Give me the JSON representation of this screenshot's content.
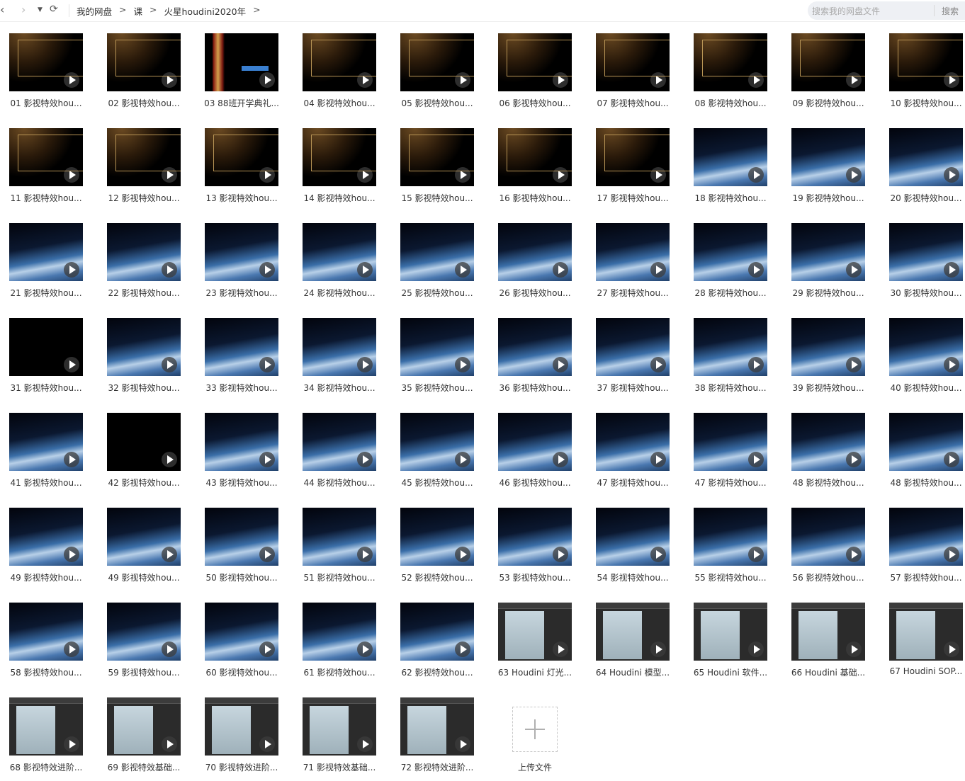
{
  "toolbar": {
    "back_icon": "chevron-left-icon",
    "forward_icon": "chevron-right-icon",
    "dropdown_icon": "caret-down-icon",
    "refresh_icon": "refresh-icon"
  },
  "breadcrumb": [
    "我的网盘",
    "课",
    "火星houdini2020年"
  ],
  "breadcrumb_separator": ">",
  "search": {
    "placeholder": "搜索我的网盘文件",
    "button": "搜索"
  },
  "files": [
    {
      "name": "01 影视特效hou...",
      "thumb": "fire"
    },
    {
      "name": "02 影视特效hou...",
      "thumb": "fire"
    },
    {
      "name": "03 88班开学典礼...",
      "thumb": "red"
    },
    {
      "name": "04 影视特效hou...",
      "thumb": "fire"
    },
    {
      "name": "05 影视特效hou...",
      "thumb": "fire"
    },
    {
      "name": "06 影视特效hou...",
      "thumb": "fire"
    },
    {
      "name": "07 影视特效hou...",
      "thumb": "fire"
    },
    {
      "name": "08 影视特效hou...",
      "thumb": "fire"
    },
    {
      "name": "09 影视特效hou...",
      "thumb": "fire"
    },
    {
      "name": "10 影视特效hou...",
      "thumb": "fire"
    },
    {
      "name": "11 影视特效hou...",
      "thumb": "fire"
    },
    {
      "name": "12 影视特效hou...",
      "thumb": "fire"
    },
    {
      "name": "13 影视特效hou...",
      "thumb": "fire"
    },
    {
      "name": "14 影视特效hou...",
      "thumb": "fire"
    },
    {
      "name": "15 影视特效hou...",
      "thumb": "fire"
    },
    {
      "name": "16 影视特效hou...",
      "thumb": "fire"
    },
    {
      "name": "17 影视特效hou...",
      "thumb": "fire"
    },
    {
      "name": "18 影视特效hou...",
      "thumb": "earth"
    },
    {
      "name": "19 影视特效hou...",
      "thumb": "earth"
    },
    {
      "name": "20 影视特效hou...",
      "thumb": "earth"
    },
    {
      "name": "21 影视特效hou...",
      "thumb": "earth"
    },
    {
      "name": "22 影视特效hou...",
      "thumb": "earth"
    },
    {
      "name": "23 影视特效hou...",
      "thumb": "earth"
    },
    {
      "name": "24 影视特效hou...",
      "thumb": "earth"
    },
    {
      "name": "25 影视特效hou...",
      "thumb": "earth"
    },
    {
      "name": "26 影视特效hou...",
      "thumb": "earth"
    },
    {
      "name": "27 影视特效hou...",
      "thumb": "earth"
    },
    {
      "name": "28 影视特效hou...",
      "thumb": "earth"
    },
    {
      "name": "29 影视特效hou...",
      "thumb": "earth"
    },
    {
      "name": "30 影视特效hou...",
      "thumb": "earth"
    },
    {
      "name": "31 影视特效hou...",
      "thumb": "black"
    },
    {
      "name": "32 影视特效hou...",
      "thumb": "earth"
    },
    {
      "name": "33 影视特效hou...",
      "thumb": "earth"
    },
    {
      "name": "34 影视特效hou...",
      "thumb": "earth"
    },
    {
      "name": "35 影视特效hou...",
      "thumb": "earth"
    },
    {
      "name": "36 影视特效hou...",
      "thumb": "earth"
    },
    {
      "name": "37 影视特效hou...",
      "thumb": "earth"
    },
    {
      "name": "38 影视特效hou...",
      "thumb": "earth"
    },
    {
      "name": "39 影视特效hou...",
      "thumb": "earth"
    },
    {
      "name": "40 影视特效hou...",
      "thumb": "earth"
    },
    {
      "name": "41 影视特效hou...",
      "thumb": "earth"
    },
    {
      "name": "42 影视特效hou...",
      "thumb": "black"
    },
    {
      "name": "43 影视特效hou...",
      "thumb": "earth"
    },
    {
      "name": "44 影视特效hou...",
      "thumb": "earth"
    },
    {
      "name": "45 影视特效hou...",
      "thumb": "earth"
    },
    {
      "name": "46 影视特效hou...",
      "thumb": "earth"
    },
    {
      "name": "47 影视特效hou...",
      "thumb": "earth"
    },
    {
      "name": "47 影视特效hou...",
      "thumb": "earth"
    },
    {
      "name": "48 影视特效hou...",
      "thumb": "earth"
    },
    {
      "name": "48 影视特效hou...",
      "thumb": "earth"
    },
    {
      "name": "49 影视特效hou...",
      "thumb": "earth"
    },
    {
      "name": "49 影视特效hou...",
      "thumb": "earth"
    },
    {
      "name": "50 影视特效hou...",
      "thumb": "earth"
    },
    {
      "name": "51 影视特效hou...",
      "thumb": "earth"
    },
    {
      "name": "52 影视特效hou...",
      "thumb": "earth"
    },
    {
      "name": "53 影视特效hou...",
      "thumb": "earth"
    },
    {
      "name": "54 影视特效hou...",
      "thumb": "earth"
    },
    {
      "name": "55 影视特效hou...",
      "thumb": "earth"
    },
    {
      "name": "56 影视特效hou...",
      "thumb": "earth"
    },
    {
      "name": "57 影视特效hou...",
      "thumb": "earth"
    },
    {
      "name": "58 影视特效hou...",
      "thumb": "earth"
    },
    {
      "name": "59 影视特效hou...",
      "thumb": "earth"
    },
    {
      "name": "60 影视特效hou...",
      "thumb": "earth"
    },
    {
      "name": "61 影视特效hou...",
      "thumb": "earth"
    },
    {
      "name": "62 影视特效hou...",
      "thumb": "earth"
    },
    {
      "name": "63 Houdini 灯光...",
      "thumb": "soft"
    },
    {
      "name": "64 Houdini 模型...",
      "thumb": "soft"
    },
    {
      "name": "65 Houdini 软件...",
      "thumb": "soft"
    },
    {
      "name": "66 Houdini 基础...",
      "thumb": "soft"
    },
    {
      "name": "67 Houdini SOP...",
      "thumb": "soft"
    },
    {
      "name": "68 影视特效进阶...",
      "thumb": "soft"
    },
    {
      "name": "69 影视特效基础...",
      "thumb": "soft"
    },
    {
      "name": "70 影视特效进阶...",
      "thumb": "soft"
    },
    {
      "name": "71 影视特效基础...",
      "thumb": "soft"
    },
    {
      "name": "72 影视特效进阶...",
      "thumb": "soft"
    }
  ],
  "upload": {
    "label": "上传文件",
    "icon": "plus-icon"
  }
}
